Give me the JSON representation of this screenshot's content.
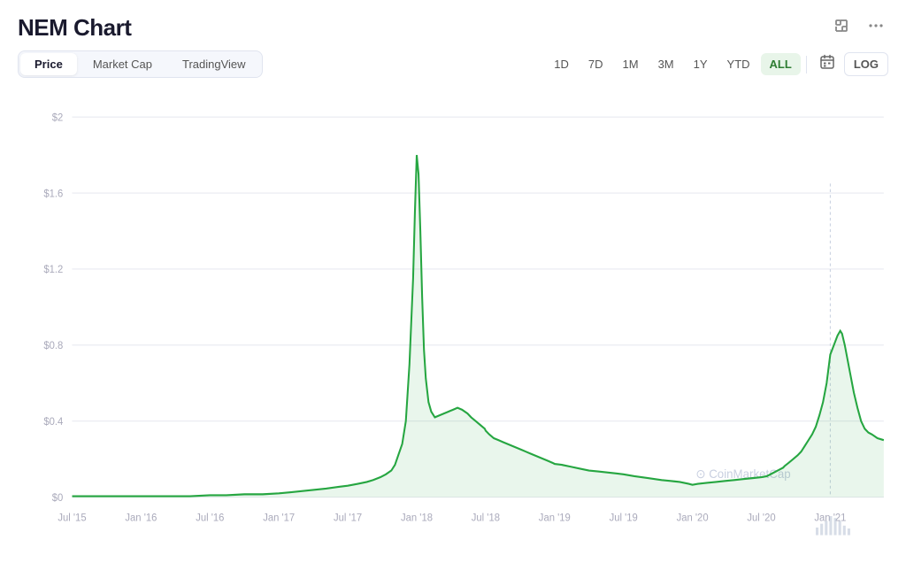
{
  "header": {
    "title": "NEM Chart",
    "expand_icon": "⛶",
    "more_icon": "•••"
  },
  "tabs": {
    "items": [
      {
        "label": "Price",
        "active": true
      },
      {
        "label": "Market Cap",
        "active": false
      },
      {
        "label": "TradingView",
        "active": false
      }
    ]
  },
  "ranges": {
    "items": [
      {
        "label": "1D",
        "active": false
      },
      {
        "label": "7D",
        "active": false
      },
      {
        "label": "1M",
        "active": false
      },
      {
        "label": "3M",
        "active": false
      },
      {
        "label": "1Y",
        "active": false
      },
      {
        "label": "YTD",
        "active": false
      },
      {
        "label": "ALL",
        "active": true
      }
    ],
    "log_label": "LOG"
  },
  "chart": {
    "y_labels": [
      "$2",
      "$1.6",
      "$1.2",
      "$0.8",
      "$0.4",
      "$0"
    ],
    "x_labels": [
      "Jul '15",
      "Jan '16",
      "Jul '16",
      "Jan '17",
      "Jul '17",
      "Jan '18",
      "Jul '18",
      "Jan '19",
      "Jul '19",
      "Jan '20",
      "Jul '20",
      "Jan '21"
    ],
    "watermark": "CoinMarketCap"
  }
}
